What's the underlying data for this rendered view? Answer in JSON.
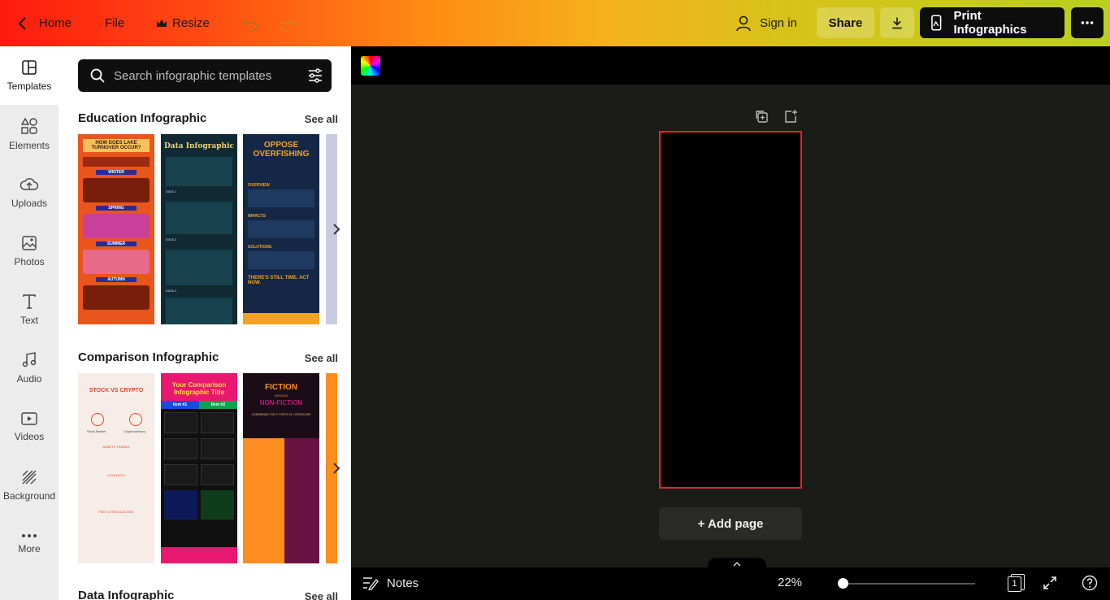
{
  "topbar": {
    "home_label": "Home",
    "file_label": "File",
    "resize_label": "Resize",
    "signin_label": "Sign in",
    "share_label": "Share",
    "print_label": "Print Infographics"
  },
  "rail": {
    "items": [
      {
        "label": "Templates",
        "icon": "templates-icon"
      },
      {
        "label": "Elements",
        "icon": "elements-icon"
      },
      {
        "label": "Uploads",
        "icon": "uploads-icon"
      },
      {
        "label": "Photos",
        "icon": "photos-icon"
      },
      {
        "label": "Text",
        "icon": "text-icon"
      },
      {
        "label": "Audio",
        "icon": "audio-icon"
      },
      {
        "label": "Videos",
        "icon": "videos-icon"
      },
      {
        "label": "Background",
        "icon": "background-icon"
      },
      {
        "label": "More",
        "icon": "more-icon"
      }
    ]
  },
  "panel": {
    "search_placeholder": "Search infographic templates",
    "sections": [
      {
        "title": "Education Infographic",
        "see_all": "See all",
        "templates": [
          {
            "title": "HOW DOES LAKE TURNOVER OCCUR?",
            "labels": [
              "WINTER",
              "SPRING",
              "SUMMER",
              "AUTUMN"
            ]
          },
          {
            "title": "Data Infographic",
            "labels": [
              "DATA 1",
              "DATA 2",
              "DATA 3"
            ]
          },
          {
            "title": "OPPOSE OVERFISHING",
            "labels": [
              "OVERVIEW",
              "IMPACTS",
              "SOLUTIONS",
              "THERE'S STILL TIME. ACT NOW."
            ]
          }
        ]
      },
      {
        "title": "Comparison Infographic",
        "see_all": "See all",
        "templates": [
          {
            "title": "STOCK VS CRYPTO",
            "labels": [
              "Stock Market",
              "Cryptocurrency",
              "ASSETS TRADED",
              "VOLATILITY",
              "FEES & REGULATIONS"
            ]
          },
          {
            "title": "Your Comparison Infographic Title",
            "labels": [
              "Item #1",
              "Item #2",
              "Point 1",
              "Point 2",
              "Point 3"
            ]
          },
          {
            "title": "FICTION",
            "labels": [
              "VERSUS",
              "NON-FICTION",
              "COMPARING THE 2 TYPES OF LITERATURE"
            ]
          }
        ]
      },
      {
        "title": "Data Infographic",
        "see_all": "See all"
      }
    ]
  },
  "bottombar": {
    "notes_label": "Notes",
    "zoom_label": "22%",
    "zoom_value": 0.0,
    "page_count": "1"
  },
  "canvas": {
    "add_page_label": "+ Add page"
  },
  "colors": {
    "accent_red": "#e5252a",
    "print_button_bg": "#0d0d0d"
  }
}
